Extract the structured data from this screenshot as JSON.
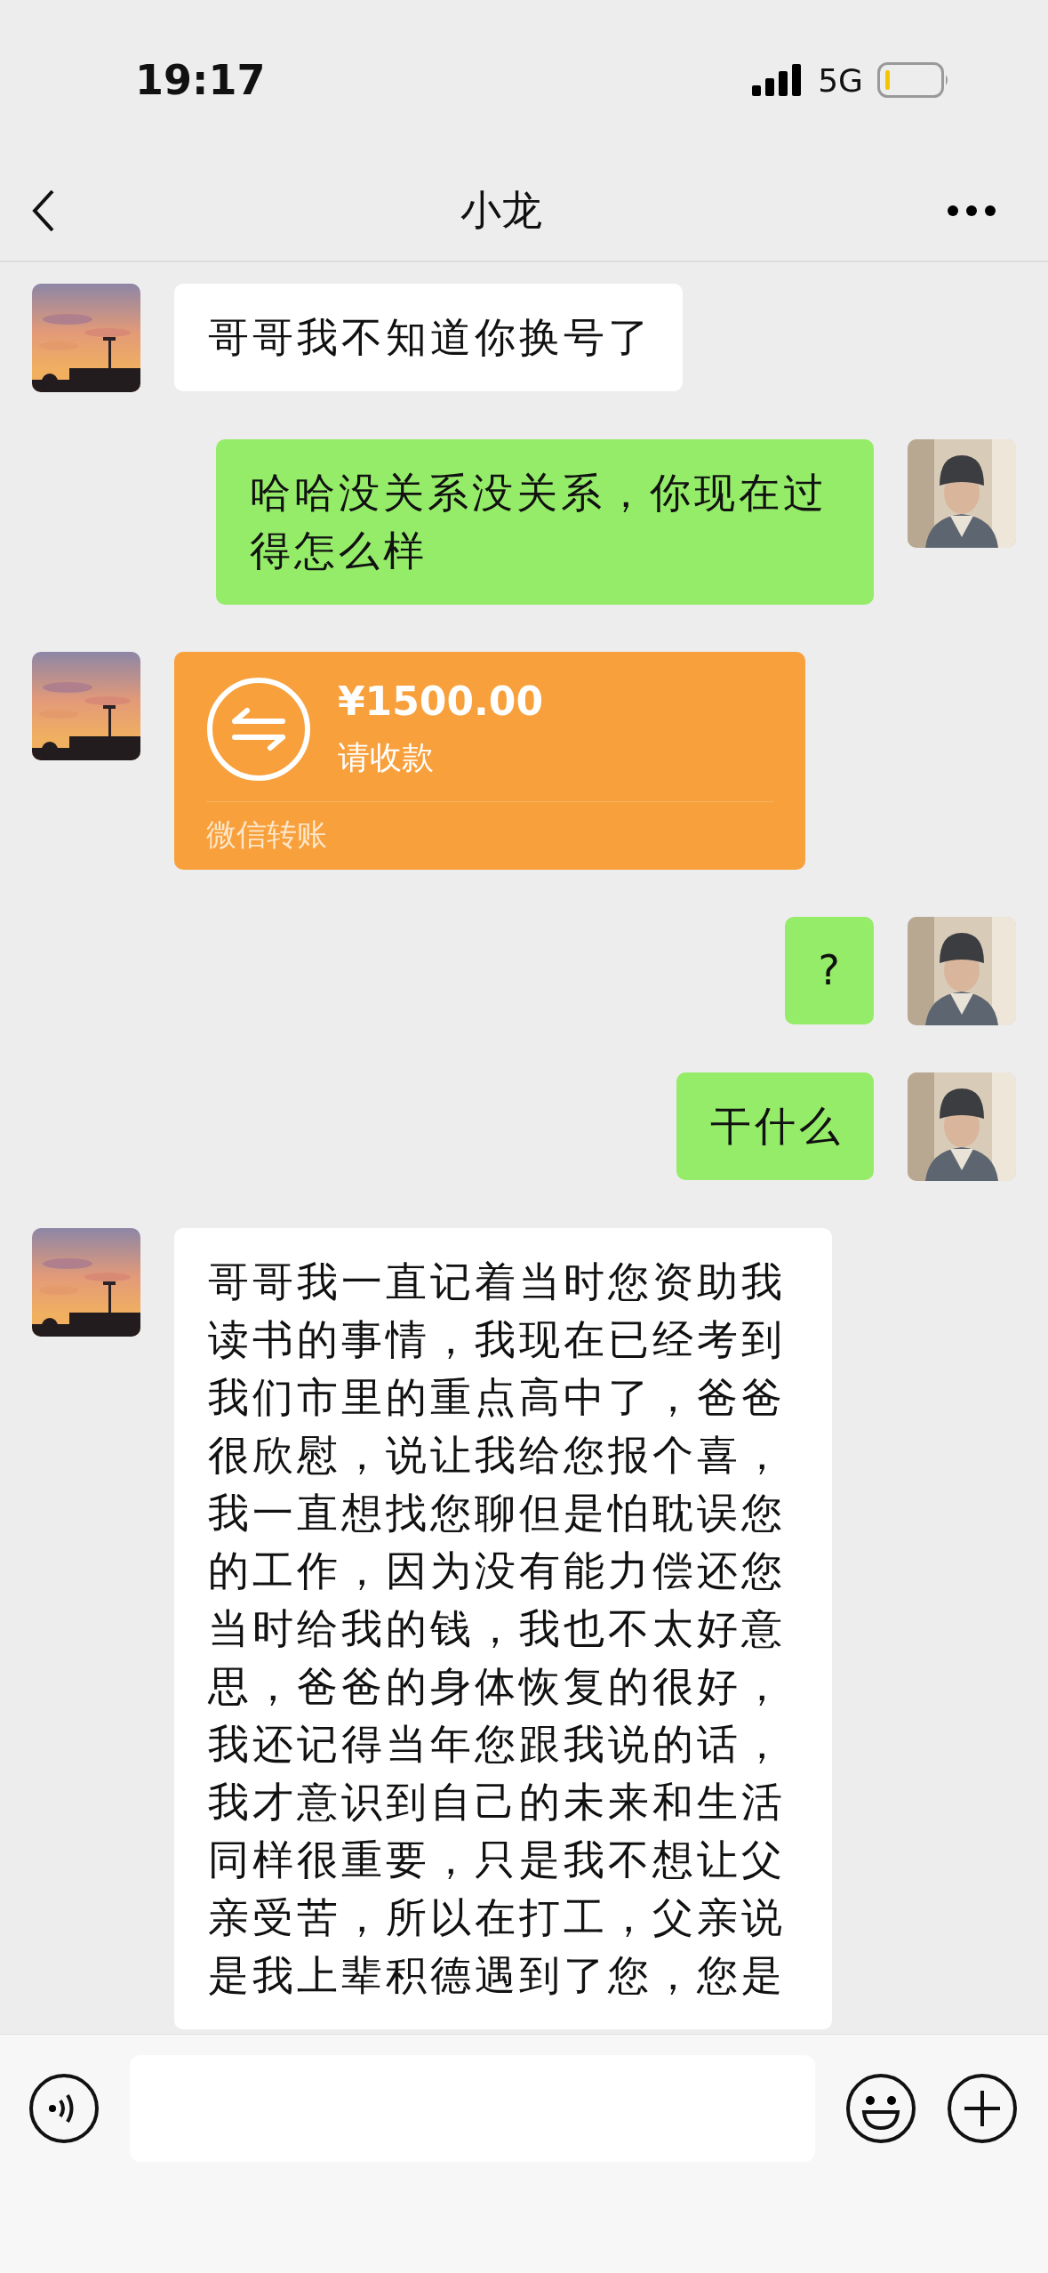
{
  "status_bar": {
    "time": "19:17",
    "network": "5G"
  },
  "nav": {
    "title": "小龙"
  },
  "messages": [
    {
      "outgoing": false,
      "kind": "text",
      "text": "哥哥我不知道你换号了"
    },
    {
      "outgoing": true,
      "kind": "text",
      "text": "哈哈没关系没关系，你现在过得怎么样"
    },
    {
      "outgoing": false,
      "kind": "transfer",
      "amount": "¥1500.00",
      "note": "请收款",
      "label": "微信转账"
    },
    {
      "outgoing": true,
      "kind": "text",
      "text": "?"
    },
    {
      "outgoing": true,
      "kind": "text",
      "text": "干什么"
    },
    {
      "outgoing": false,
      "kind": "text",
      "text": "哥哥我一直记着当时您资助我读书的事情，我现在已经考到我们市里的重点高中了，爸爸很欣慰，说让我给您报个喜，我一直想找您聊但是怕耽误您的工作，因为没有能力偿还您当时给我的钱，我也不太好意思，爸爸的身体恢复的很好，我还记得当年您跟我说的话，我才意识到自己的未来和生活同样很重要，只是我不想让父亲受苦，所以在打工，父亲说是我上辈积德遇到了您，您是"
    }
  ]
}
